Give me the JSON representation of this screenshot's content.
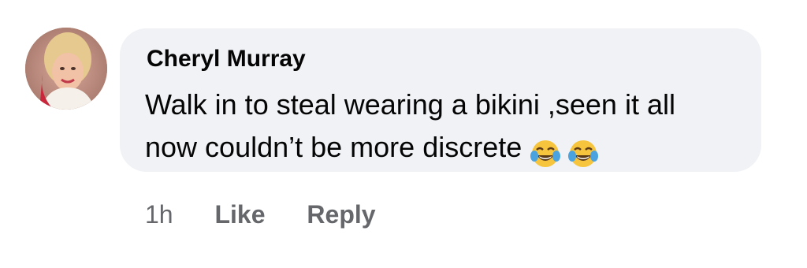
{
  "comment": {
    "author": "Cheryl Murray",
    "text_lines": [
      "Walk in to steal wearing a bikini ,seen it all",
      "now couldn’t be more discrete"
    ],
    "emojis": [
      "face-with-tears-of-joy-icon",
      "face-with-tears-of-joy-icon"
    ]
  },
  "actions": {
    "time": "1h",
    "like_label": "Like",
    "reply_label": "Reply"
  },
  "colors": {
    "bubble": "#f0f2f5",
    "text": "#050505",
    "secondary_text": "#65676b",
    "emoji_face": "#f7c53d",
    "emoji_tears": "#4aa3df"
  }
}
